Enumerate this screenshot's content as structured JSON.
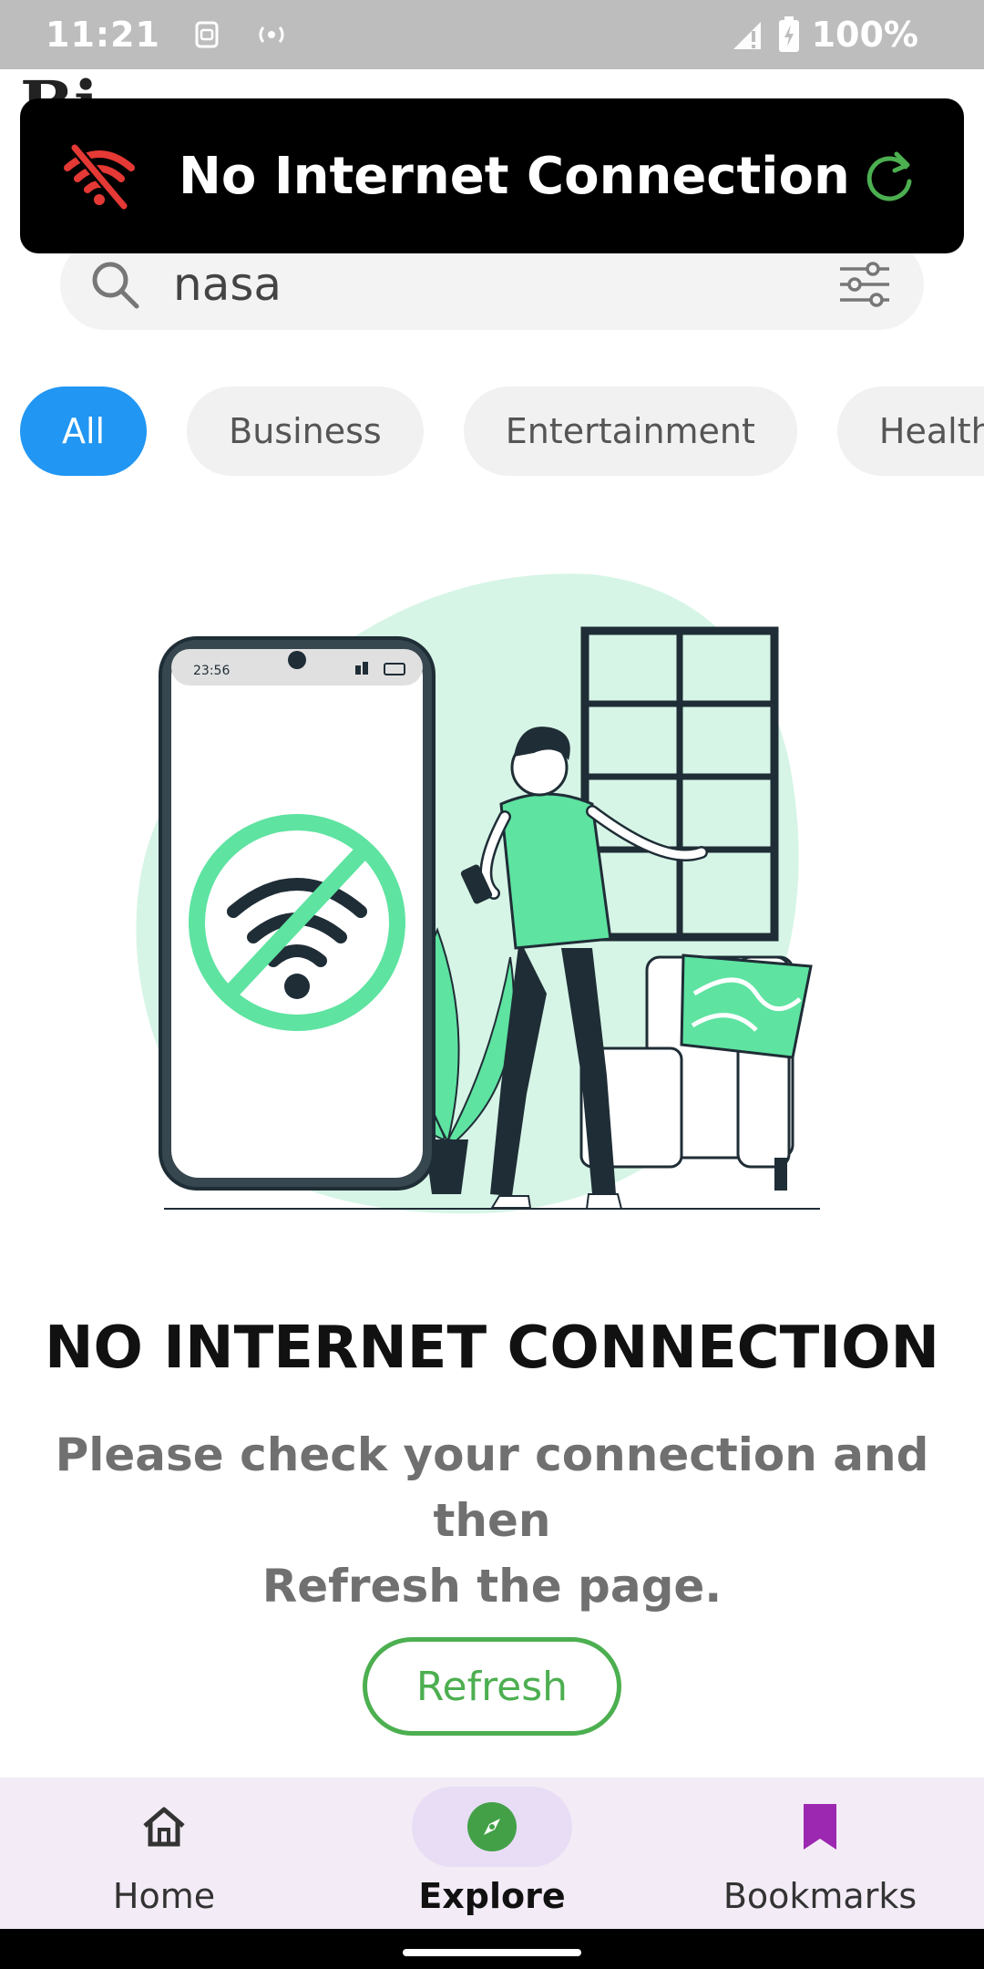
{
  "status_bar": {
    "time": "11:21",
    "battery": "100%",
    "icons": [
      "sim-icon",
      "hotspot-icon",
      "signal-icon",
      "battery-charging-icon"
    ]
  },
  "app": {
    "title": "Bi"
  },
  "banner": {
    "text": "No Internet Connection",
    "icon": "wifi-off-icon",
    "action_icon": "refresh-icon",
    "colors": {
      "icon": "#e53935",
      "action": "#4caf50",
      "background": "#000000"
    }
  },
  "search": {
    "value": "nasa",
    "icon": "search-icon",
    "filter_icon": "filter-icon"
  },
  "categories": {
    "items": [
      "All",
      "Business",
      "Entertainment",
      "Health"
    ],
    "active": "All",
    "active_color": "#2196f3"
  },
  "illustration": {
    "phone_time": "23:56",
    "description_icon": "no-wifi-illustration"
  },
  "message": {
    "headline": "NO INTERNET CONNECTION",
    "line1": "Please check your connection and then",
    "line2": "Refresh the page.",
    "button": "Refresh"
  },
  "bottom_nav": {
    "items": [
      {
        "label": "Home",
        "icon": "home-icon"
      },
      {
        "label": "Explore",
        "icon": "compass-icon"
      },
      {
        "label": "Bookmarks",
        "icon": "bookmark-icon"
      }
    ],
    "active": "Explore"
  }
}
